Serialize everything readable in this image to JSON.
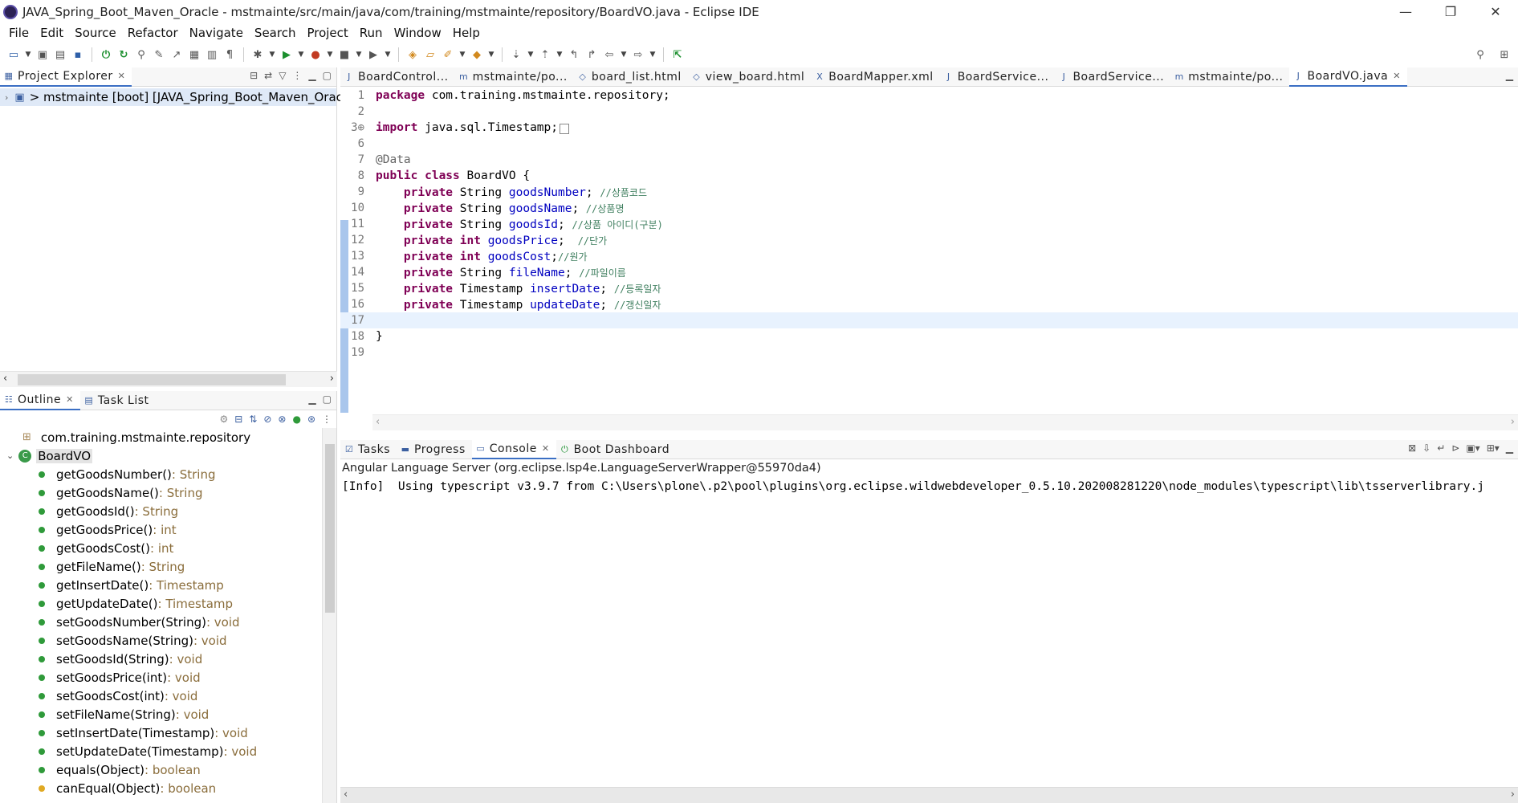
{
  "window": {
    "title": "JAVA_Spring_Boot_Maven_Oracle - mstmainte/src/main/java/com/training/mstmainte/repository/BoardVO.java - Eclipse IDE",
    "minimize": "—",
    "maximize": "❐",
    "close": "✕"
  },
  "menu": [
    "File",
    "Edit",
    "Source",
    "Refactor",
    "Navigate",
    "Search",
    "Project",
    "Run",
    "Window",
    "Help"
  ],
  "explorer": {
    "tab_label": "Project Explorer",
    "project_row": "> mstmainte [boot] [JAVA_Spring_Boot_Maven_Oracle"
  },
  "outline": {
    "tab_label": "Outline",
    "task_tab_label": "Task List",
    "package": "com.training.mstmainte.repository",
    "class_name": "BoardVO",
    "members": [
      {
        "name": "getGoodsNumber()",
        "type": " : String"
      },
      {
        "name": "getGoodsName()",
        "type": " : String"
      },
      {
        "name": "getGoodsId()",
        "type": " : String"
      },
      {
        "name": "getGoodsPrice()",
        "type": " : int"
      },
      {
        "name": "getGoodsCost()",
        "type": " : int"
      },
      {
        "name": "getFileName()",
        "type": " : String"
      },
      {
        "name": "getInsertDate()",
        "type": " : Timestamp"
      },
      {
        "name": "getUpdateDate()",
        "type": " : Timestamp"
      },
      {
        "name": "setGoodsNumber(String)",
        "type": " : void"
      },
      {
        "name": "setGoodsName(String)",
        "type": " : void"
      },
      {
        "name": "setGoodsId(String)",
        "type": " : void"
      },
      {
        "name": "setGoodsPrice(int)",
        "type": " : void"
      },
      {
        "name": "setGoodsCost(int)",
        "type": " : void"
      },
      {
        "name": "setFileName(String)",
        "type": " : void"
      },
      {
        "name": "setInsertDate(Timestamp)",
        "type": " : void"
      },
      {
        "name": "setUpdateDate(Timestamp)",
        "type": " : void"
      },
      {
        "name": "equals(Object)",
        "type": " : boolean"
      },
      {
        "name": "canEqual(Object)",
        "type": " : boolean"
      }
    ]
  },
  "editor": {
    "tabs": [
      "BoardControl...",
      "mstmainte/po...",
      "board_list.html",
      "view_board.html",
      "BoardMapper.xml",
      "BoardService...",
      "BoardService...",
      "mstmainte/po...",
      "BoardVO.java"
    ],
    "lines": {
      "1": {
        "a": "package",
        "b": " com.training.mstmainte.repository;"
      },
      "3": {
        "a": "import",
        "b": " java.sql.Timestamp;"
      },
      "7": "@Data",
      "8": {
        "a": "public class",
        "b": " BoardVO {"
      },
      "fields": [
        {
          "num": "9",
          "type": "String ",
          "name": "goodsNumber",
          "comment": "//상품코드"
        },
        {
          "num": "10",
          "type": "String ",
          "name": "goodsName",
          "comment": "//상품명"
        },
        {
          "num": "11",
          "type": "String ",
          "name": "goodsId",
          "comment": "//상품 아이디(구분)"
        },
        {
          "num": "12",
          "type": "int ",
          "name": "goodsPrice",
          "comment": " //단가"
        },
        {
          "num": "13",
          "type": "int ",
          "name": "goodsCost",
          "comment": "//원가"
        },
        {
          "num": "14",
          "type": "String ",
          "name": "fileName",
          "comment": "//파일이름"
        },
        {
          "num": "15",
          "type": "Timestamp ",
          "name": "insertDate",
          "comment": "//등록일자"
        },
        {
          "num": "16",
          "type": "Timestamp ",
          "name": "updateDate",
          "comment": "//갱신일자"
        }
      ],
      "18": "}"
    }
  },
  "console": {
    "tabs": [
      "Tasks",
      "Progress",
      "Console",
      "Boot Dashboard"
    ],
    "subtitle": "Angular Language Server (org.eclipse.lsp4e.LanguageServerWrapper@55970da4)",
    "output": "[Info]  Using typescript v3.9.7 from C:\\Users\\plone\\.p2\\pool\\plugins\\org.eclipse.wildwebdeveloper_0.5.10.202008281220\\node_modules\\typescript\\lib\\tsserverlibrary.j"
  }
}
